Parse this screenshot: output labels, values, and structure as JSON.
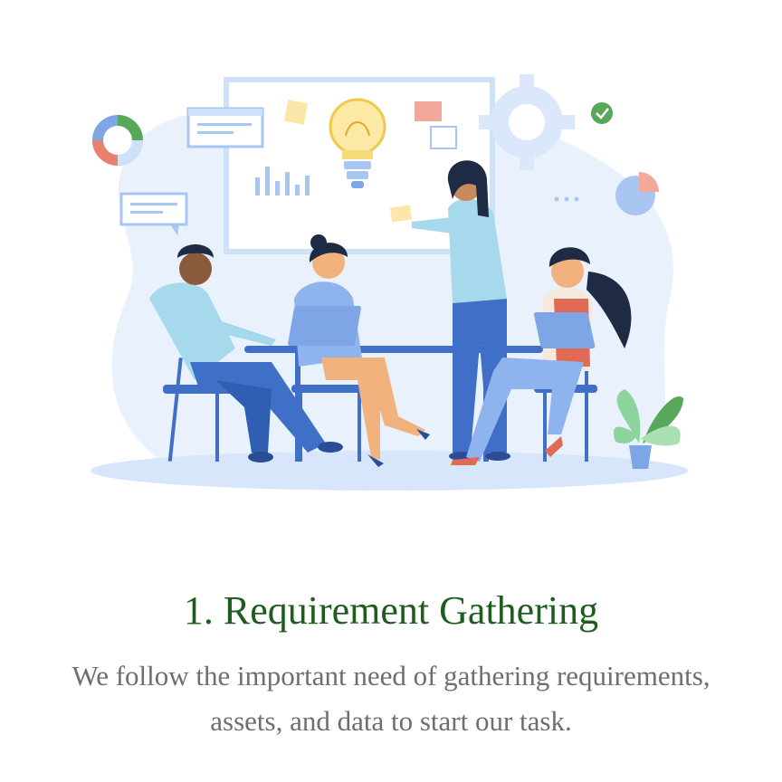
{
  "step": {
    "title": "1. Requirement Gathering",
    "description": "We follow the important need of gathering requirements, assets, and data to start our task."
  },
  "illustration": {
    "subject": "team-meeting",
    "colors": {
      "primary": "#3f6fc6",
      "light": "#dbe8fb",
      "accent": "#e8826f",
      "green": "#57a85a"
    }
  }
}
